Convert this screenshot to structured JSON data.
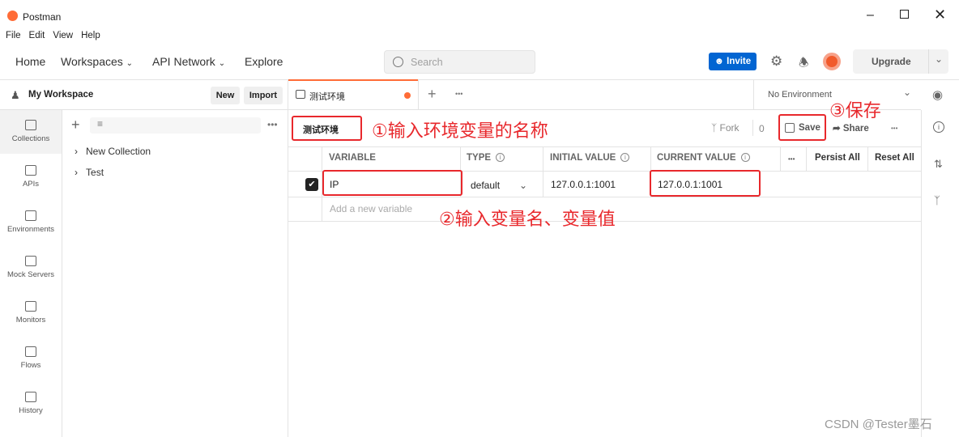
{
  "app": {
    "title": "Postman",
    "window_controls": [
      "minimize",
      "maximize",
      "close"
    ]
  },
  "menu": [
    "File",
    "Edit",
    "View",
    "Help"
  ],
  "nav": {
    "home": "Home",
    "workspaces": "Workspaces",
    "api_network": "API Network",
    "explore": "Explore",
    "search_placeholder": "Search",
    "invite": "Invite",
    "upgrade": "Upgrade"
  },
  "workspace": {
    "name": "My Workspace",
    "new": "New",
    "import": "Import"
  },
  "rail": [
    {
      "label": "Collections",
      "icon": "collections-icon"
    },
    {
      "label": "APIs",
      "icon": "apis-icon"
    },
    {
      "label": "Environments",
      "icon": "environments-icon"
    },
    {
      "label": "Mock Servers",
      "icon": "mock-servers-icon"
    },
    {
      "label": "Monitors",
      "icon": "monitors-icon"
    },
    {
      "label": "Flows",
      "icon": "flows-icon"
    },
    {
      "label": "History",
      "icon": "history-icon"
    }
  ],
  "collections": [
    "New Collection",
    "Test"
  ],
  "tab": {
    "label": "测试环境",
    "unsaved": true,
    "accent": "#ff6c37"
  },
  "environment_select": "No Environment",
  "env": {
    "name": "测试环境",
    "fork": "Fork",
    "fork_count": "0",
    "save": "Save",
    "share": "Share"
  },
  "table": {
    "headers": [
      "VARIABLE",
      "TYPE",
      "INITIAL VALUE",
      "CURRENT VALUE"
    ],
    "persist_all": "Persist All",
    "reset_all": "Reset All",
    "rows": [
      {
        "checked": true,
        "variable": "IP",
        "type": "default",
        "initial": "127.0.0.1:1001",
        "current": "127.0.0.1:1001"
      }
    ],
    "add_placeholder": "Add a new variable"
  },
  "annotations": {
    "a1": "①输入环境变量的名称",
    "a2": "②输入变量名、变量值",
    "a3": "③保存",
    "color": "#e8282c"
  },
  "watermark": "CSDN @Tester墨石"
}
